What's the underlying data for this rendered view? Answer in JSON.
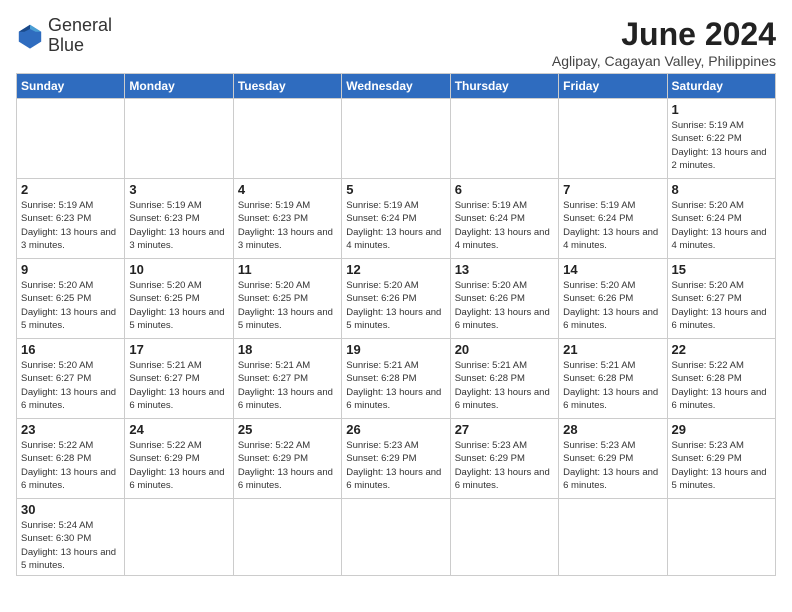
{
  "header": {
    "logo_line1": "General",
    "logo_line2": "Blue",
    "month_title": "June 2024",
    "location": "Aglipay, Cagayan Valley, Philippines"
  },
  "days_of_week": [
    "Sunday",
    "Monday",
    "Tuesday",
    "Wednesday",
    "Thursday",
    "Friday",
    "Saturday"
  ],
  "weeks": [
    [
      {
        "day": "",
        "info": ""
      },
      {
        "day": "",
        "info": ""
      },
      {
        "day": "",
        "info": ""
      },
      {
        "day": "",
        "info": ""
      },
      {
        "day": "",
        "info": ""
      },
      {
        "day": "",
        "info": ""
      },
      {
        "day": "1",
        "info": "Sunrise: 5:19 AM\nSunset: 6:22 PM\nDaylight: 13 hours and 2 minutes."
      }
    ],
    [
      {
        "day": "2",
        "info": "Sunrise: 5:19 AM\nSunset: 6:23 PM\nDaylight: 13 hours and 3 minutes."
      },
      {
        "day": "3",
        "info": "Sunrise: 5:19 AM\nSunset: 6:23 PM\nDaylight: 13 hours and 3 minutes."
      },
      {
        "day": "4",
        "info": "Sunrise: 5:19 AM\nSunset: 6:23 PM\nDaylight: 13 hours and 3 minutes."
      },
      {
        "day": "5",
        "info": "Sunrise: 5:19 AM\nSunset: 6:24 PM\nDaylight: 13 hours and 4 minutes."
      },
      {
        "day": "6",
        "info": "Sunrise: 5:19 AM\nSunset: 6:24 PM\nDaylight: 13 hours and 4 minutes."
      },
      {
        "day": "7",
        "info": "Sunrise: 5:19 AM\nSunset: 6:24 PM\nDaylight: 13 hours and 4 minutes."
      },
      {
        "day": "8",
        "info": "Sunrise: 5:20 AM\nSunset: 6:24 PM\nDaylight: 13 hours and 4 minutes."
      }
    ],
    [
      {
        "day": "9",
        "info": "Sunrise: 5:20 AM\nSunset: 6:25 PM\nDaylight: 13 hours and 5 minutes."
      },
      {
        "day": "10",
        "info": "Sunrise: 5:20 AM\nSunset: 6:25 PM\nDaylight: 13 hours and 5 minutes."
      },
      {
        "day": "11",
        "info": "Sunrise: 5:20 AM\nSunset: 6:25 PM\nDaylight: 13 hours and 5 minutes."
      },
      {
        "day": "12",
        "info": "Sunrise: 5:20 AM\nSunset: 6:26 PM\nDaylight: 13 hours and 5 minutes."
      },
      {
        "day": "13",
        "info": "Sunrise: 5:20 AM\nSunset: 6:26 PM\nDaylight: 13 hours and 6 minutes."
      },
      {
        "day": "14",
        "info": "Sunrise: 5:20 AM\nSunset: 6:26 PM\nDaylight: 13 hours and 6 minutes."
      },
      {
        "day": "15",
        "info": "Sunrise: 5:20 AM\nSunset: 6:27 PM\nDaylight: 13 hours and 6 minutes."
      }
    ],
    [
      {
        "day": "16",
        "info": "Sunrise: 5:20 AM\nSunset: 6:27 PM\nDaylight: 13 hours and 6 minutes."
      },
      {
        "day": "17",
        "info": "Sunrise: 5:21 AM\nSunset: 6:27 PM\nDaylight: 13 hours and 6 minutes."
      },
      {
        "day": "18",
        "info": "Sunrise: 5:21 AM\nSunset: 6:27 PM\nDaylight: 13 hours and 6 minutes."
      },
      {
        "day": "19",
        "info": "Sunrise: 5:21 AM\nSunset: 6:28 PM\nDaylight: 13 hours and 6 minutes."
      },
      {
        "day": "20",
        "info": "Sunrise: 5:21 AM\nSunset: 6:28 PM\nDaylight: 13 hours and 6 minutes."
      },
      {
        "day": "21",
        "info": "Sunrise: 5:21 AM\nSunset: 6:28 PM\nDaylight: 13 hours and 6 minutes."
      },
      {
        "day": "22",
        "info": "Sunrise: 5:22 AM\nSunset: 6:28 PM\nDaylight: 13 hours and 6 minutes."
      }
    ],
    [
      {
        "day": "23",
        "info": "Sunrise: 5:22 AM\nSunset: 6:28 PM\nDaylight: 13 hours and 6 minutes."
      },
      {
        "day": "24",
        "info": "Sunrise: 5:22 AM\nSunset: 6:29 PM\nDaylight: 13 hours and 6 minutes."
      },
      {
        "day": "25",
        "info": "Sunrise: 5:22 AM\nSunset: 6:29 PM\nDaylight: 13 hours and 6 minutes."
      },
      {
        "day": "26",
        "info": "Sunrise: 5:23 AM\nSunset: 6:29 PM\nDaylight: 13 hours and 6 minutes."
      },
      {
        "day": "27",
        "info": "Sunrise: 5:23 AM\nSunset: 6:29 PM\nDaylight: 13 hours and 6 minutes."
      },
      {
        "day": "28",
        "info": "Sunrise: 5:23 AM\nSunset: 6:29 PM\nDaylight: 13 hours and 6 minutes."
      },
      {
        "day": "29",
        "info": "Sunrise: 5:23 AM\nSunset: 6:29 PM\nDaylight: 13 hours and 5 minutes."
      }
    ],
    [
      {
        "day": "30",
        "info": "Sunrise: 5:24 AM\nSunset: 6:30 PM\nDaylight: 13 hours and 5 minutes."
      },
      {
        "day": "",
        "info": ""
      },
      {
        "day": "",
        "info": ""
      },
      {
        "day": "",
        "info": ""
      },
      {
        "day": "",
        "info": ""
      },
      {
        "day": "",
        "info": ""
      },
      {
        "day": "",
        "info": ""
      }
    ]
  ]
}
